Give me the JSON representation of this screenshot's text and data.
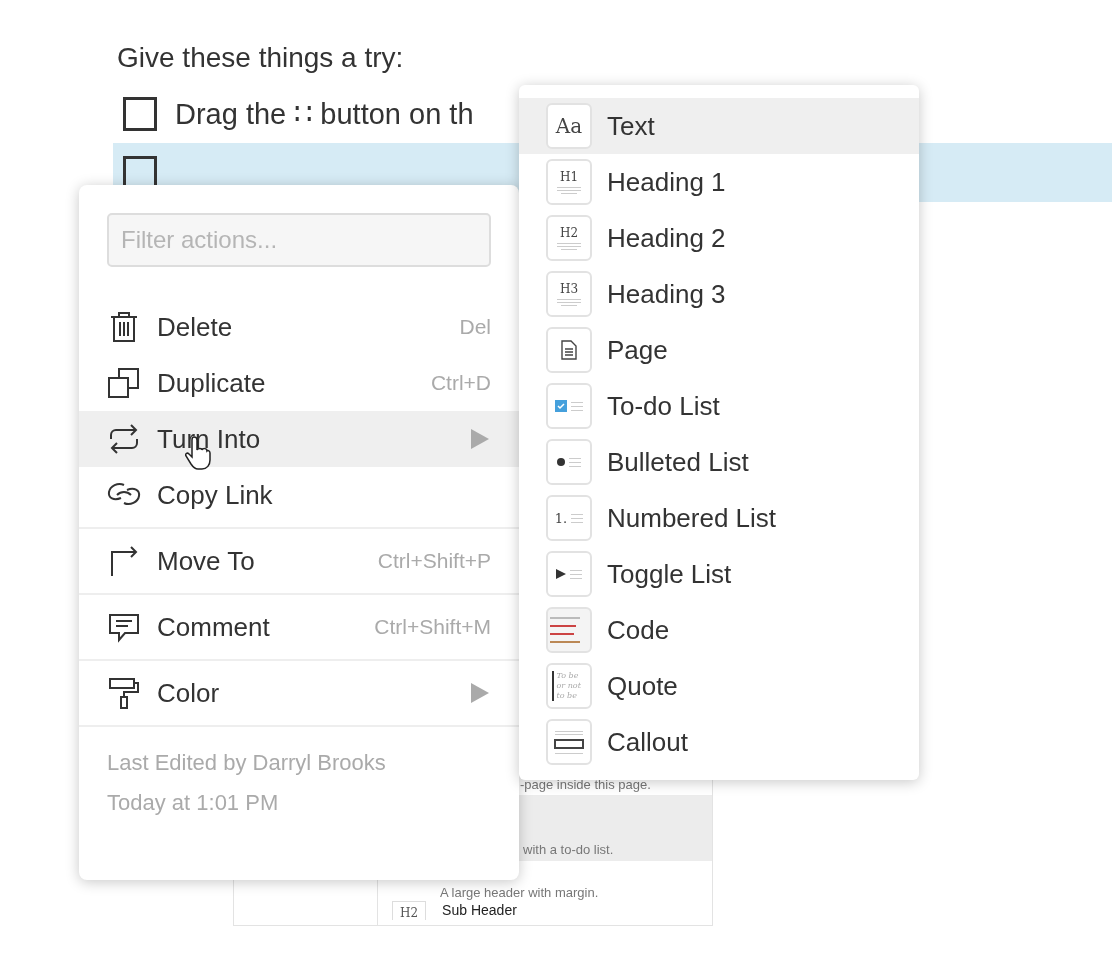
{
  "page": {
    "heading": "Give these things a try:",
    "todos": [
      {
        "text": "Drag the ∷ button on th",
        "checked": false,
        "selected": false
      },
      {
        "checked": false,
        "selected": true
      }
    ]
  },
  "background_preview": {
    "rows": [
      {
        "text": "-page inside this page.",
        "highlighted": false
      },
      {
        "text": "with a to-do list.",
        "highlighted": true
      },
      {
        "text": "A large header with margin.",
        "highlighted": false
      },
      {
        "badge": "H2",
        "text": "Sub Header",
        "highlighted": false
      }
    ]
  },
  "context_menu": {
    "filter": {
      "placeholder": "Filter actions..."
    },
    "groups": [
      [
        {
          "kind": "delete",
          "label": "Delete",
          "shortcut": "Del",
          "hovered": false
        },
        {
          "kind": "duplicate",
          "label": "Duplicate",
          "shortcut": "Ctrl+D",
          "hovered": false
        },
        {
          "kind": "turn-into",
          "label": "Turn Into",
          "submenu": true,
          "hovered": true
        },
        {
          "kind": "link",
          "label": "Copy Link",
          "hovered": false
        }
      ],
      [
        {
          "kind": "move",
          "label": "Move To",
          "shortcut": "Ctrl+Shift+P",
          "hovered": false
        }
      ],
      [
        {
          "kind": "comment",
          "label": "Comment",
          "shortcut": "Ctrl+Shift+M",
          "hovered": false
        }
      ],
      [
        {
          "kind": "color",
          "label": "Color",
          "submenu": true,
          "hovered": false
        }
      ]
    ],
    "footer": [
      "Last Edited by Darryl Brooks",
      "Today at 1:01 PM"
    ]
  },
  "turn_into_menu": {
    "items": [
      {
        "kind": "text",
        "icon_text": "Aa",
        "label": "Text",
        "selected": true
      },
      {
        "kind": "heading",
        "icon_text": "H1",
        "label": "Heading 1",
        "selected": false
      },
      {
        "kind": "heading",
        "icon_text": "H2",
        "label": "Heading 2",
        "selected": false
      },
      {
        "kind": "heading",
        "icon_text": "H3",
        "label": "Heading 3",
        "selected": false
      },
      {
        "kind": "page",
        "label": "Page",
        "selected": false
      },
      {
        "kind": "todo",
        "label": "To-do List",
        "selected": false
      },
      {
        "kind": "bulleted",
        "label": "Bulleted List",
        "selected": false
      },
      {
        "kind": "numbered",
        "icon_text": "1.",
        "label": "Numbered List",
        "selected": false
      },
      {
        "kind": "toggle",
        "label": "Toggle List",
        "selected": false
      },
      {
        "kind": "code",
        "label": "Code",
        "selected": false
      },
      {
        "kind": "quote",
        "icon_text": "To be or not to be",
        "label": "Quote",
        "selected": false
      },
      {
        "kind": "callout",
        "label": "Callout",
        "selected": false
      }
    ]
  }
}
